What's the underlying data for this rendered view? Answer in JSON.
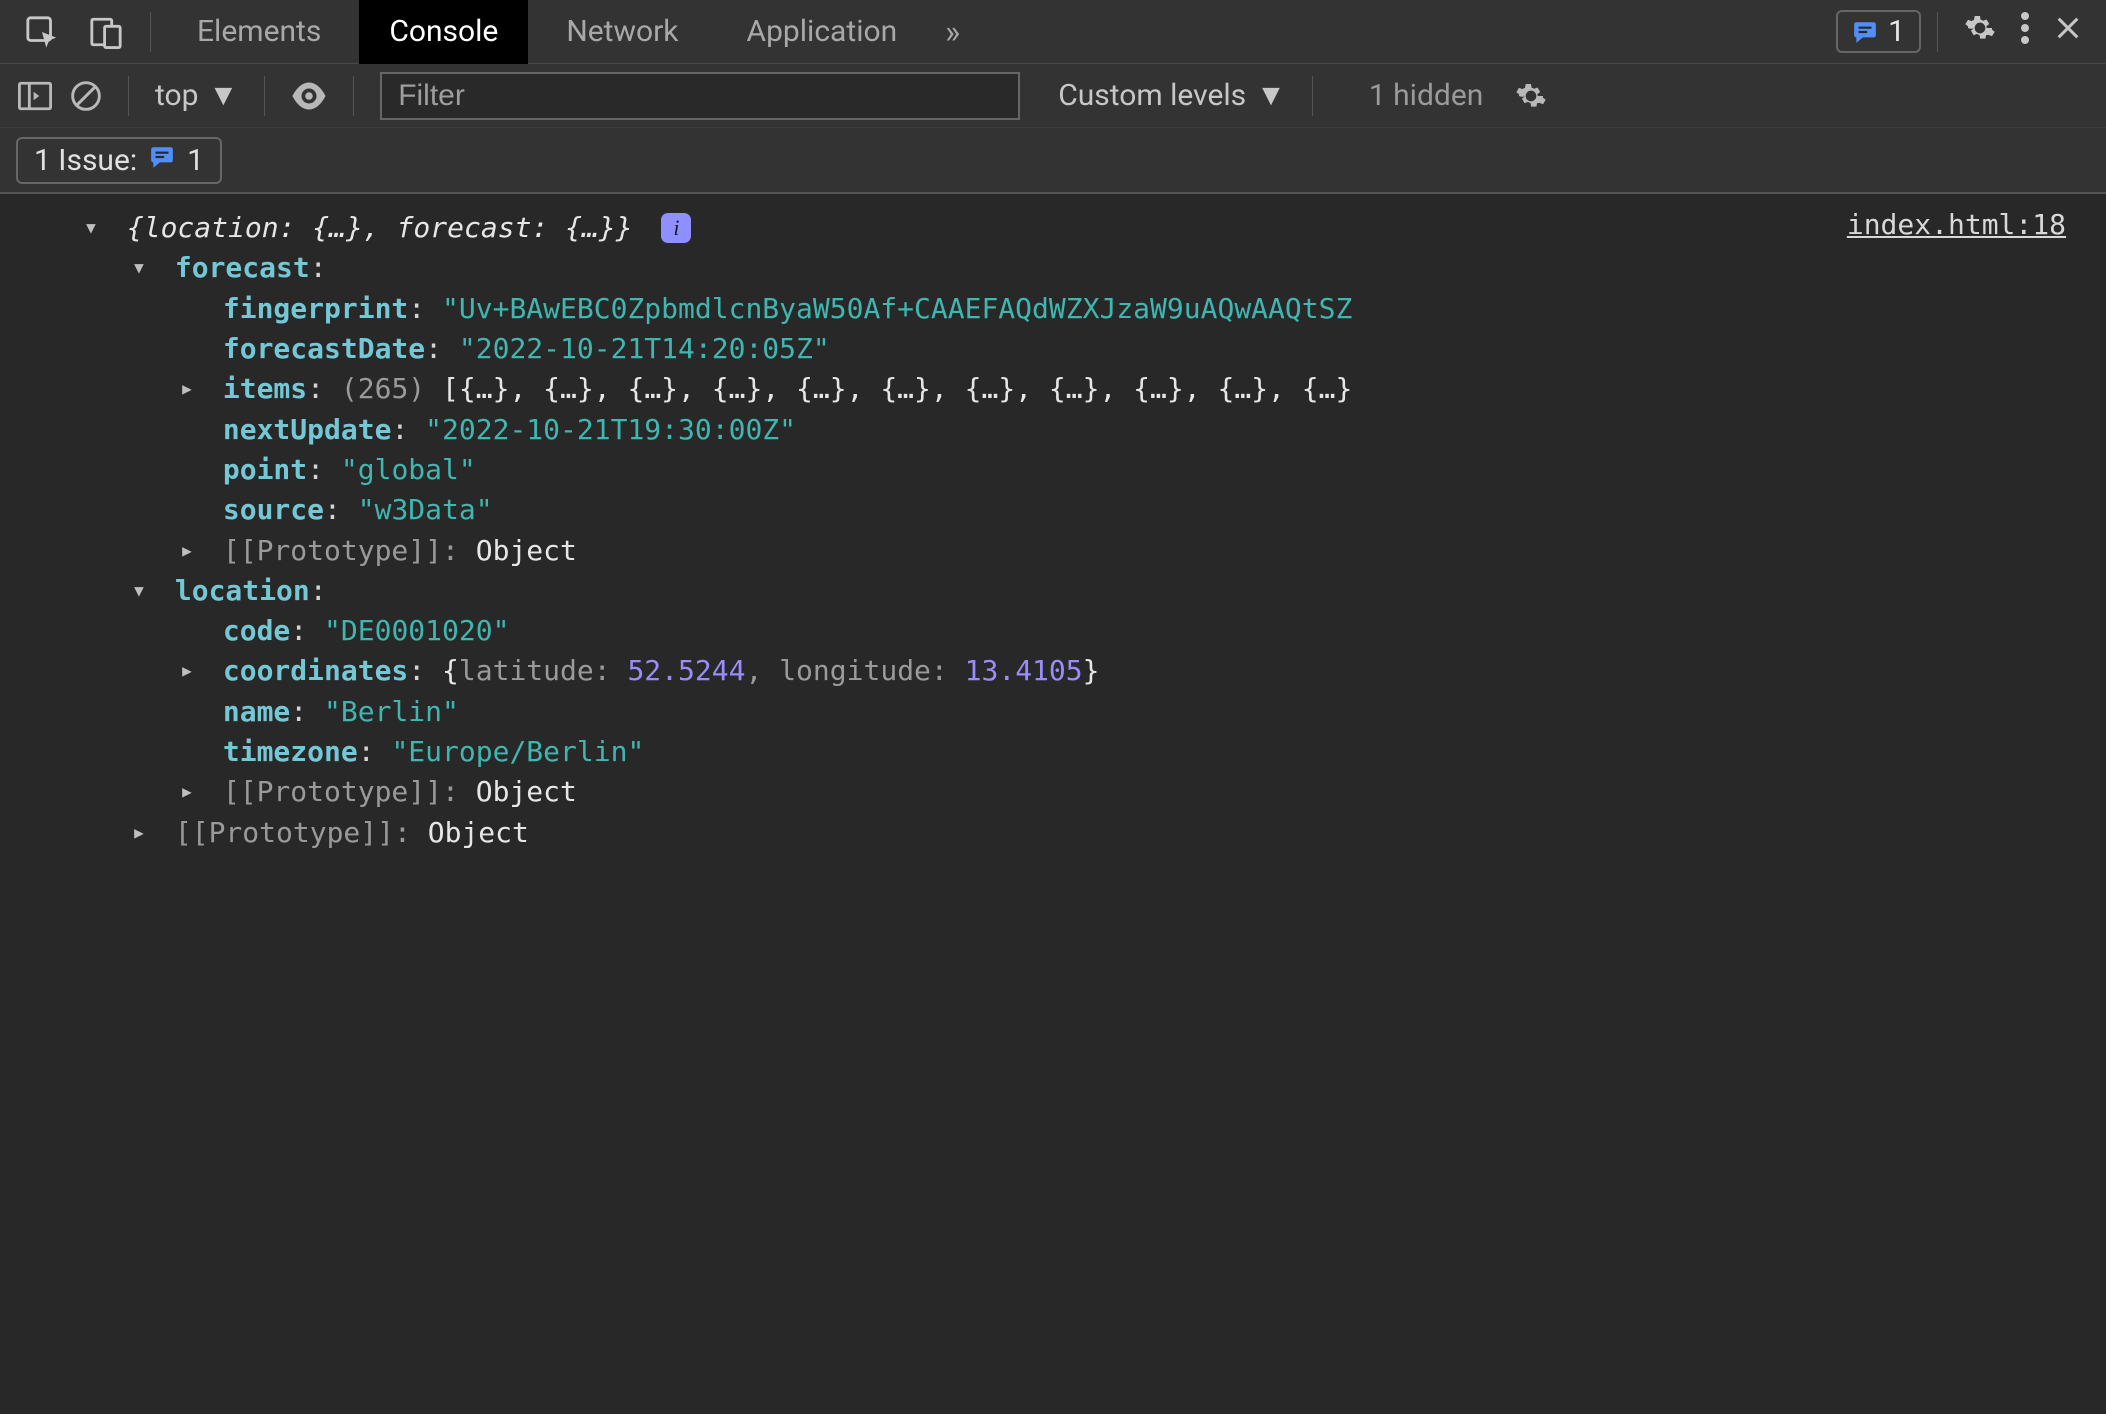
{
  "tabs": {
    "elements": "Elements",
    "console": "Console",
    "network": "Network",
    "application": "Application"
  },
  "tabbar": {
    "issues_count": "1"
  },
  "toolbar": {
    "context": "top",
    "filter_placeholder": "Filter",
    "levels_label": "Custom levels",
    "hidden_label": "1 hidden"
  },
  "issues": {
    "label": "1 Issue:",
    "count": "1"
  },
  "source": {
    "link": "index.html:18"
  },
  "log": {
    "summary": "{location: {…}, forecast: {…}}",
    "forecast_key": "forecast",
    "forecast": {
      "fingerprint_key": "fingerprint",
      "fingerprint_val": "\"Uv+BAwEBC0ZpbmdlcnByaW50Af+CAAEFAQdWZXJzaW9uAQwAAQtSZ",
      "forecastDate_key": "forecastDate",
      "forecastDate_val": "\"2022-10-21T14:20:05Z\"",
      "items_key": "items",
      "items_count": "(265)",
      "nextUpdate_key": "nextUpdate",
      "nextUpdate_val": "\"2022-10-21T19:30:00Z\"",
      "point_key": "point",
      "point_val": "\"global\"",
      "source_key": "source",
      "source_val": "\"w3Data\"",
      "proto_label": "[[Prototype]]",
      "proto_val": "Object"
    },
    "location_key": "location",
    "location": {
      "code_key": "code",
      "code_val": "\"DE0001020\"",
      "coordinates_key": "coordinates",
      "coord_lat_key": "latitude",
      "coord_lat_val": "52.5244",
      "coord_lng_key": "longitude",
      "coord_lng_val": "13.4105",
      "name_key": "name",
      "name_val": "\"Berlin\"",
      "timezone_key": "timezone",
      "timezone_val": "\"Europe/Berlin\"",
      "proto_label": "[[Prototype]]",
      "proto_val": "Object"
    },
    "root_proto_label": "[[Prototype]]",
    "root_proto_val": "Object"
  }
}
